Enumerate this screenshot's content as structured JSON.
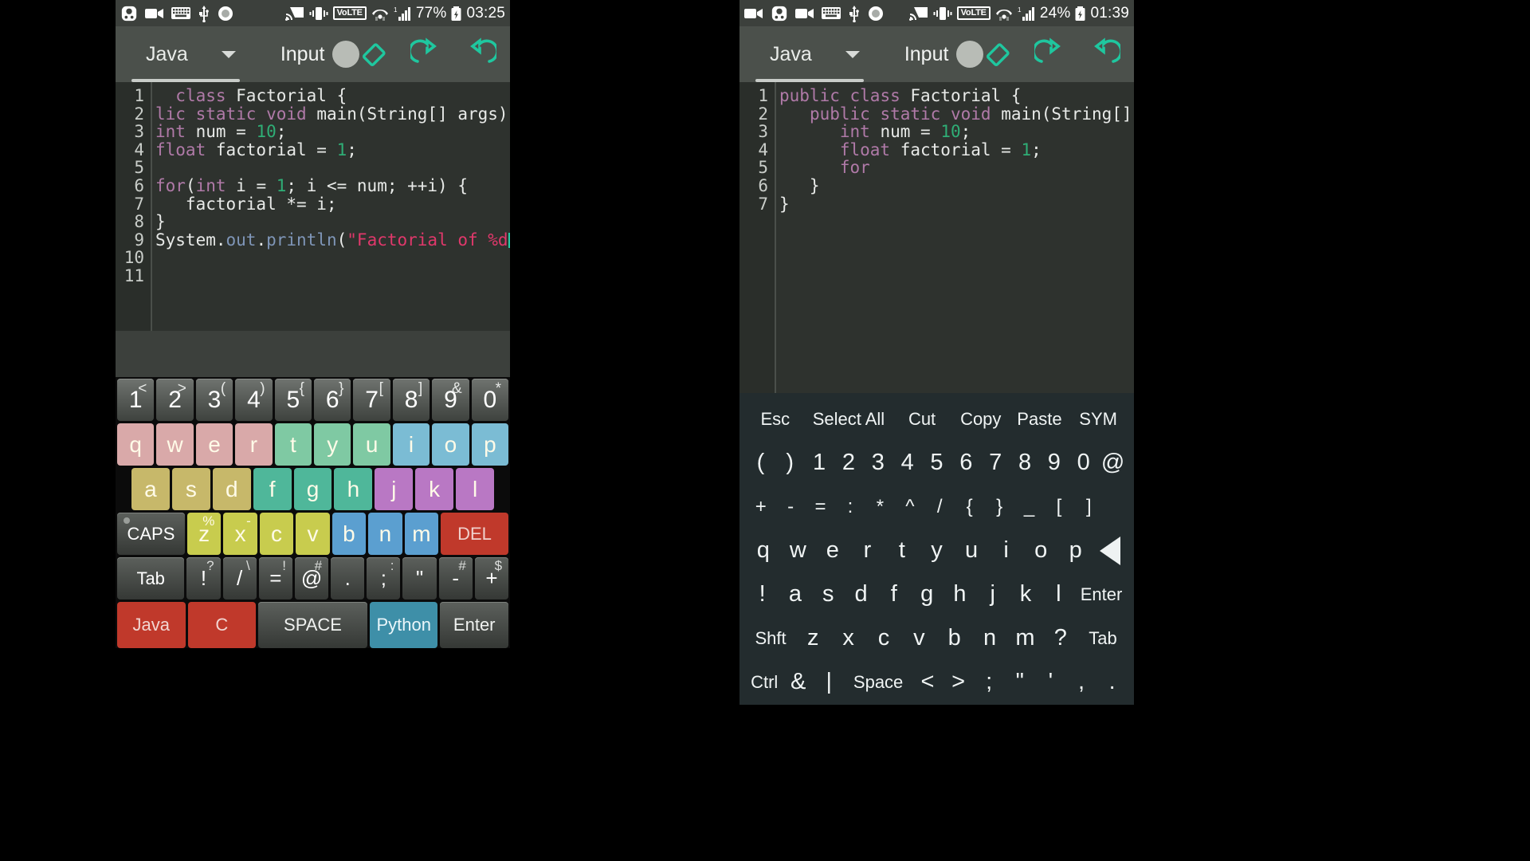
{
  "left_phone": {
    "status_bar": {
      "icons_left": [
        "app-notification-icon",
        "video-camera-icon",
        "keyboard-icon",
        "usb-icon",
        "record-icon"
      ],
      "icons_right": [
        "cast-icon",
        "vibrate-icon",
        "volte-badge",
        "wifi-icon",
        "signal-icon"
      ],
      "volte_label": "VoLTE",
      "battery": "77%",
      "time": "03:25"
    },
    "toolbar": {
      "language": "Java",
      "input_label": "Input",
      "input_toggle_on": false,
      "actions": [
        "eraser-icon",
        "undo-icon",
        "redo-icon"
      ]
    },
    "editor": {
      "line_numbers": [
        "1",
        "2",
        "3",
        "4",
        "5",
        "6",
        "7",
        "8",
        "9",
        "10",
        "11"
      ],
      "lines": [
        [
          {
            "t": "  ",
            "c": "plain"
          },
          {
            "t": "class",
            "c": "kw"
          },
          {
            "t": " Factorial {",
            "c": "plain"
          }
        ],
        [
          {
            "t": "lic ",
            "c": "kw"
          },
          {
            "t": "static ",
            "c": "kw"
          },
          {
            "t": "void",
            "c": "kw"
          },
          {
            "t": " main(String[] args)",
            "c": "plain"
          }
        ],
        [
          {
            "t": "int",
            "c": "kw"
          },
          {
            "t": " num = ",
            "c": "plain"
          },
          {
            "t": "10",
            "c": "num"
          },
          {
            "t": ";",
            "c": "plain"
          }
        ],
        [
          {
            "t": "float",
            "c": "kw"
          },
          {
            "t": " factorial = ",
            "c": "plain"
          },
          {
            "t": "1",
            "c": "num"
          },
          {
            "t": ";",
            "c": "plain"
          }
        ],
        [],
        [
          {
            "t": "for",
            "c": "kw"
          },
          {
            "t": "(",
            "c": "plain"
          },
          {
            "t": "int",
            "c": "kw"
          },
          {
            "t": " i = ",
            "c": "plain"
          },
          {
            "t": "1",
            "c": "num"
          },
          {
            "t": "; i <= num; ++i) {",
            "c": "plain"
          }
        ],
        [
          {
            "t": "   factorial *= i;",
            "c": "plain"
          }
        ],
        [
          {
            "t": "}",
            "c": "plain"
          }
        ],
        [
          {
            "t": "System.",
            "c": "plain"
          },
          {
            "t": "out",
            "c": "fn"
          },
          {
            "t": ".",
            "c": "plain"
          },
          {
            "t": "println",
            "c": "fn"
          },
          {
            "t": "(",
            "c": "plain"
          },
          {
            "t": "\"Factorial of %d",
            "c": "str"
          },
          {
            "t": "|",
            "c": "cursor"
          }
        ],
        [],
        []
      ]
    },
    "keyboard": {
      "row_numbers": [
        {
          "main": "1",
          "sup": "<"
        },
        {
          "main": "2",
          "sup": ">"
        },
        {
          "main": "3",
          "sup": "("
        },
        {
          "main": "4",
          "sup": ")"
        },
        {
          "main": "5",
          "sup": "{"
        },
        {
          "main": "6",
          "sup": "}"
        },
        {
          "main": "7",
          "sup": "["
        },
        {
          "main": "8",
          "sup": "]"
        },
        {
          "main": "9",
          "sup": "&"
        },
        {
          "main": "0",
          "sup": "*"
        }
      ],
      "row_q": [
        "q",
        "w",
        "e",
        "r",
        "t",
        "y",
        "u",
        "i",
        "o",
        "p"
      ],
      "row_a": [
        "a",
        "s",
        "d",
        "f",
        "g",
        "h",
        "j",
        "k",
        "l"
      ],
      "row_z": [
        "z",
        "x",
        "c",
        "v",
        "b",
        "n",
        "m"
      ],
      "caps_label": "CAPS",
      "del_label": "DEL",
      "row_sym": [
        {
          "main": "Tab",
          "sup": "",
          "sup2": ""
        },
        {
          "main": "!",
          "sup": "?",
          "sup2": ""
        },
        {
          "main": "/",
          "sup": "\\",
          "sup2": ""
        },
        {
          "main": "=",
          "sup": "!",
          "sup2": ""
        },
        {
          "main": "@",
          "sup": "#",
          "sup2": ""
        },
        {
          "main": ".",
          "sup": "",
          "sup2": ""
        },
        {
          "main": ";",
          "sup": ":",
          "sup2": ""
        },
        {
          "main": "\"",
          "sup": "",
          "sup2": ""
        },
        {
          "main": "-",
          "sup": "#",
          "sup2": ""
        },
        {
          "main": "+",
          "sup": "$",
          "sup2": ""
        }
      ],
      "row_bottom": [
        {
          "label": "Java",
          "kind": "java"
        },
        {
          "label": "C",
          "kind": "c"
        },
        {
          "label": "SPACE",
          "kind": "space"
        },
        {
          "label": "Python",
          "kind": "python"
        },
        {
          "label": "Enter",
          "kind": "enter"
        }
      ]
    }
  },
  "right_phone": {
    "status_bar": {
      "icons_left": [
        "video-camera-icon",
        "app-notification-icon",
        "video-camera-icon",
        "keyboard-icon",
        "usb-icon",
        "record-icon"
      ],
      "icons_right": [
        "cast-icon",
        "vibrate-icon",
        "volte-badge",
        "wifi-icon",
        "signal-icon"
      ],
      "volte_label": "VoLTE",
      "battery": "24%",
      "time": "01:39"
    },
    "toolbar": {
      "language": "Java",
      "input_label": "Input",
      "input_toggle_on": false,
      "actions": [
        "eraser-icon",
        "undo-icon",
        "redo-icon"
      ]
    },
    "editor": {
      "line_numbers": [
        "1",
        "2",
        "3",
        "4",
        "5",
        "6",
        "7"
      ],
      "lines": [
        [
          {
            "t": "public ",
            "c": "kw"
          },
          {
            "t": "class",
            "c": "kw"
          },
          {
            "t": " Factorial {",
            "c": "plain"
          }
        ],
        [
          {
            "t": "   ",
            "c": "plain"
          },
          {
            "t": "public ",
            "c": "kw"
          },
          {
            "t": "static ",
            "c": "kw"
          },
          {
            "t": "void",
            "c": "kw"
          },
          {
            "t": " main(String[] a",
            "c": "plain"
          }
        ],
        [
          {
            "t": "      ",
            "c": "plain"
          },
          {
            "t": "int",
            "c": "kw"
          },
          {
            "t": " num = ",
            "c": "plain"
          },
          {
            "t": "10",
            "c": "num"
          },
          {
            "t": ";",
            "c": "plain"
          }
        ],
        [
          {
            "t": "      ",
            "c": "plain"
          },
          {
            "t": "float",
            "c": "kw"
          },
          {
            "t": " factorial = ",
            "c": "plain"
          },
          {
            "t": "1",
            "c": "num"
          },
          {
            "t": ";",
            "c": "plain"
          }
        ],
        [
          {
            "t": "      ",
            "c": "plain"
          },
          {
            "t": "for",
            "c": "kw"
          }
        ],
        [
          {
            "t": "   }",
            "c": "plain"
          }
        ],
        [
          {
            "t": "}",
            "c": "plain"
          }
        ]
      ]
    },
    "keyboard": {
      "row_cmd": [
        "Esc",
        "Select All",
        "Cut",
        "Copy",
        "Paste",
        "SYM"
      ],
      "row_num": [
        "(",
        ")",
        "1",
        "2",
        "3",
        "4",
        "5",
        "6",
        "7",
        "8",
        "9",
        "0",
        "@"
      ],
      "row_sym": [
        "+",
        "-",
        "=",
        ":",
        "*",
        "^",
        "/",
        "{",
        "}",
        "_",
        "[",
        "]"
      ],
      "row_q": [
        "q",
        "w",
        "e",
        "r",
        "t",
        "y",
        "u",
        "i",
        "o",
        "p",
        "backspace-icon"
      ],
      "row_a": [
        "!",
        "a",
        "s",
        "d",
        "f",
        "g",
        "h",
        "j",
        "k",
        "l",
        "Enter"
      ],
      "row_z": [
        "Shft",
        "z",
        "x",
        "c",
        "v",
        "b",
        "n",
        "m",
        "?",
        "Tab"
      ],
      "row_bottom": [
        "Ctrl",
        "&",
        "|",
        "Space",
        "<",
        ">",
        ";",
        "\"",
        "'",
        ",",
        "."
      ]
    }
  }
}
